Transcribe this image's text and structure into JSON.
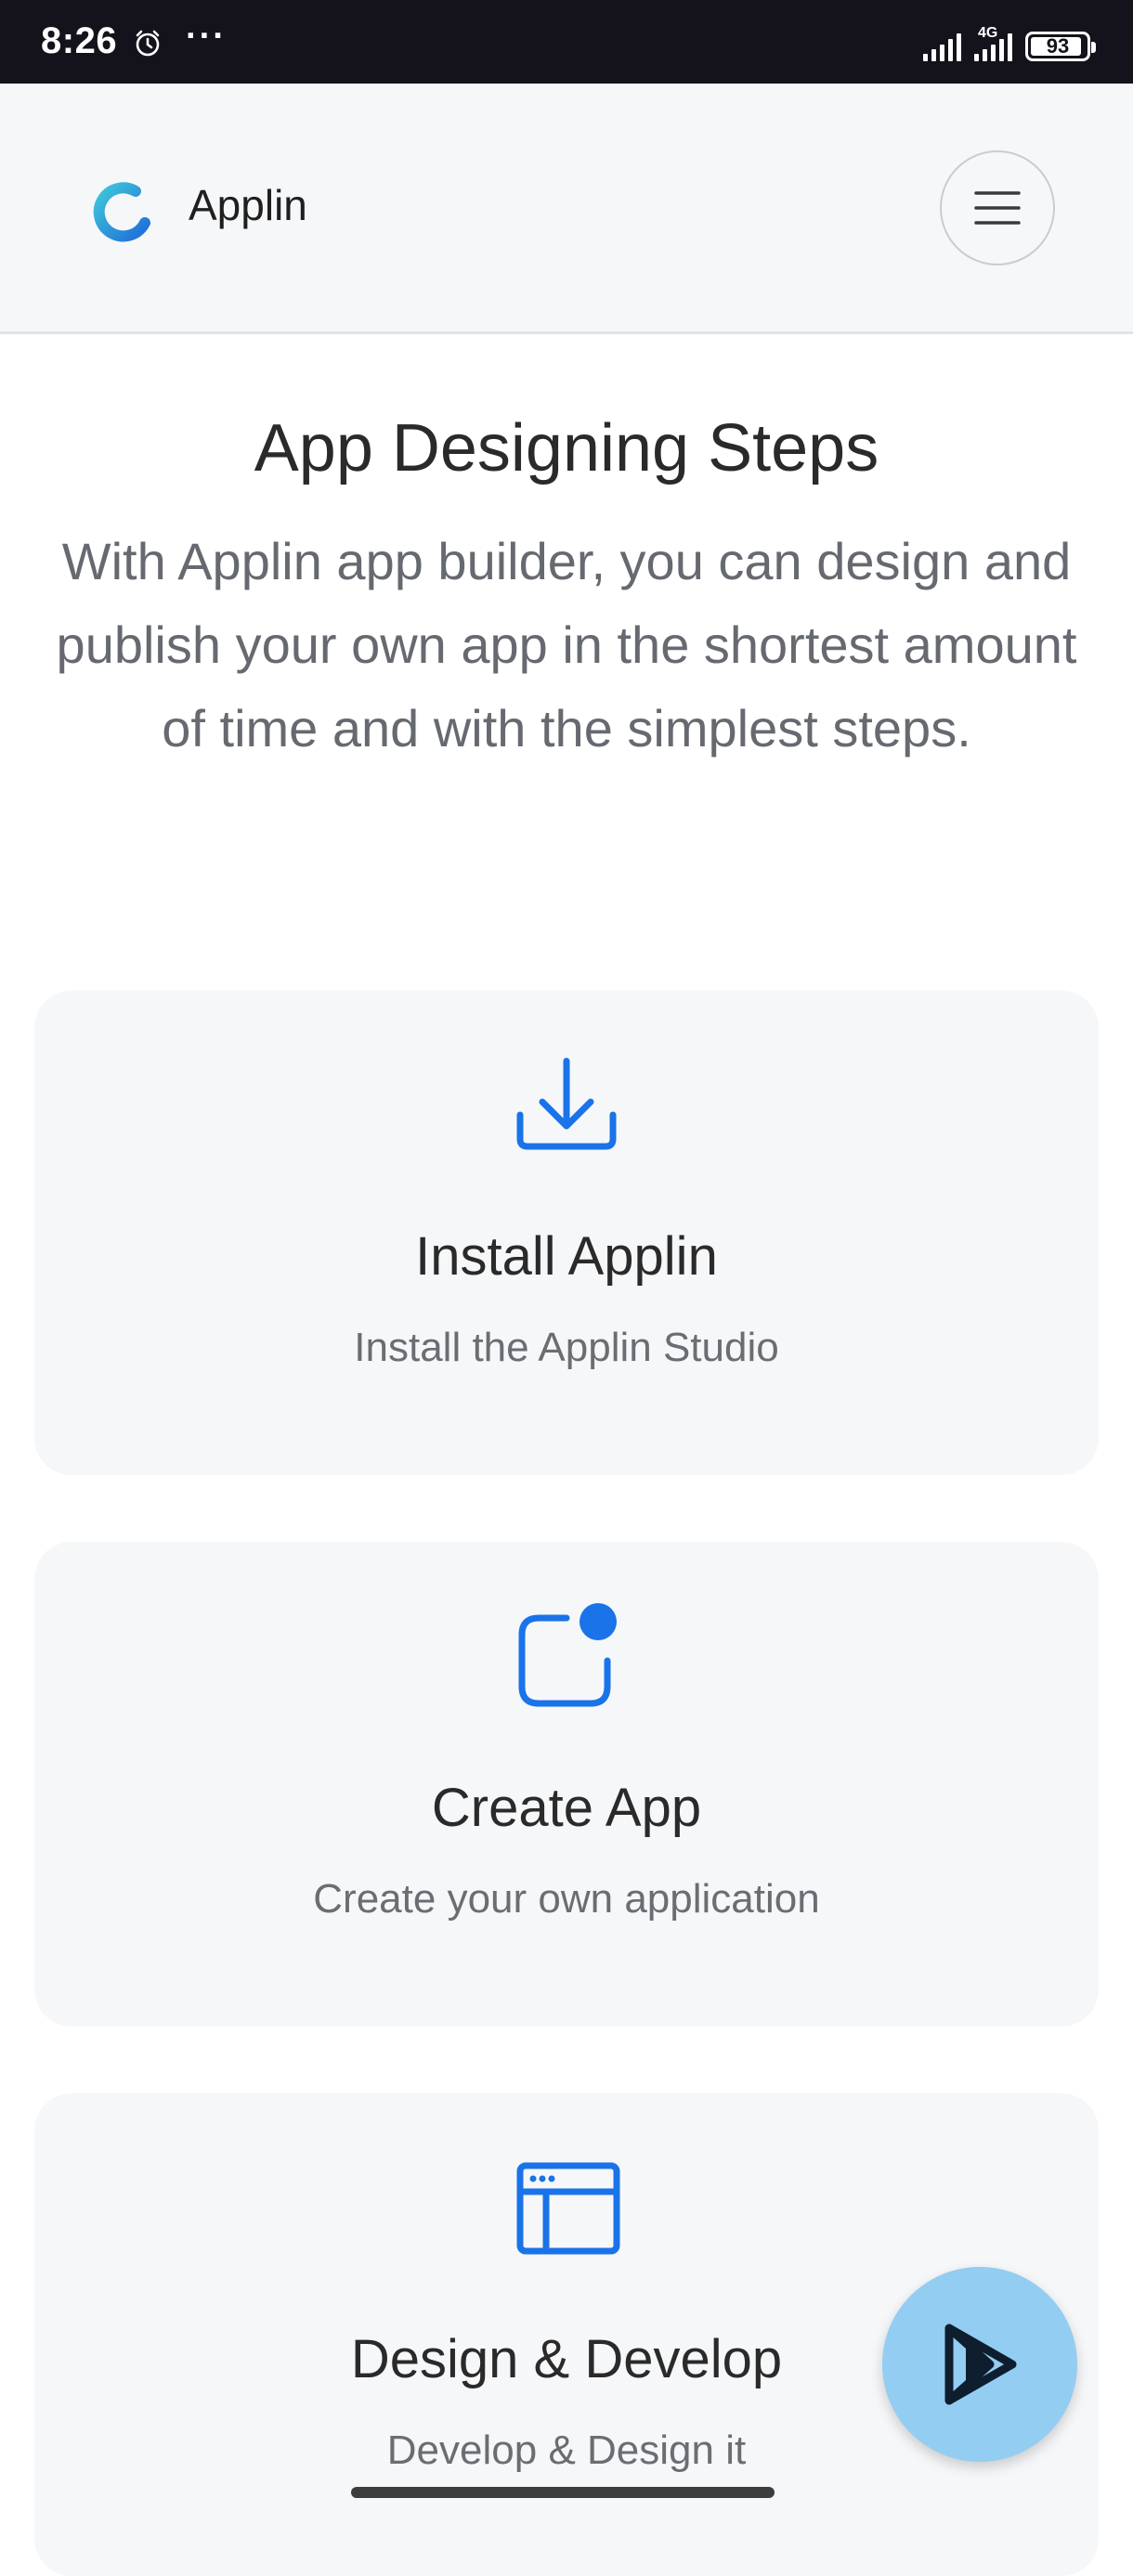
{
  "status_bar": {
    "time": "8:26",
    "overflow": "···",
    "network": "4G",
    "battery_level": 93,
    "battery_label": "93",
    "icons": [
      "alarm-icon",
      "signal-icon",
      "battery-icon"
    ]
  },
  "header": {
    "brand": "Applin",
    "logo_icon": "applin-logo-icon",
    "menu_icon": "hamburger-menu-icon",
    "colors": {
      "logo_start": "#3fc6d9",
      "logo_end": "#1e6fd8",
      "background": "#f6f7f9"
    }
  },
  "intro": {
    "title": "App Designing Steps",
    "subtitle": "With Applin app builder, you can design and publish your own app in the shortest amount of time and with the simplest steps."
  },
  "steps": [
    {
      "icon": "download-icon",
      "title": "Install Applin",
      "description": "Install the Applin Studio"
    },
    {
      "icon": "app-notification-icon",
      "title": "Create App",
      "description": "Create your own application"
    },
    {
      "icon": "browser-window-icon",
      "title": "Design & Develop",
      "description": "Develop & Design it"
    }
  ],
  "fab": {
    "icon": "google-play-icon",
    "color": "#93cdf2"
  },
  "colors": {
    "accent": "#1a73e8",
    "card_background": "#f6f7f9",
    "status_bar": "#14121a"
  }
}
